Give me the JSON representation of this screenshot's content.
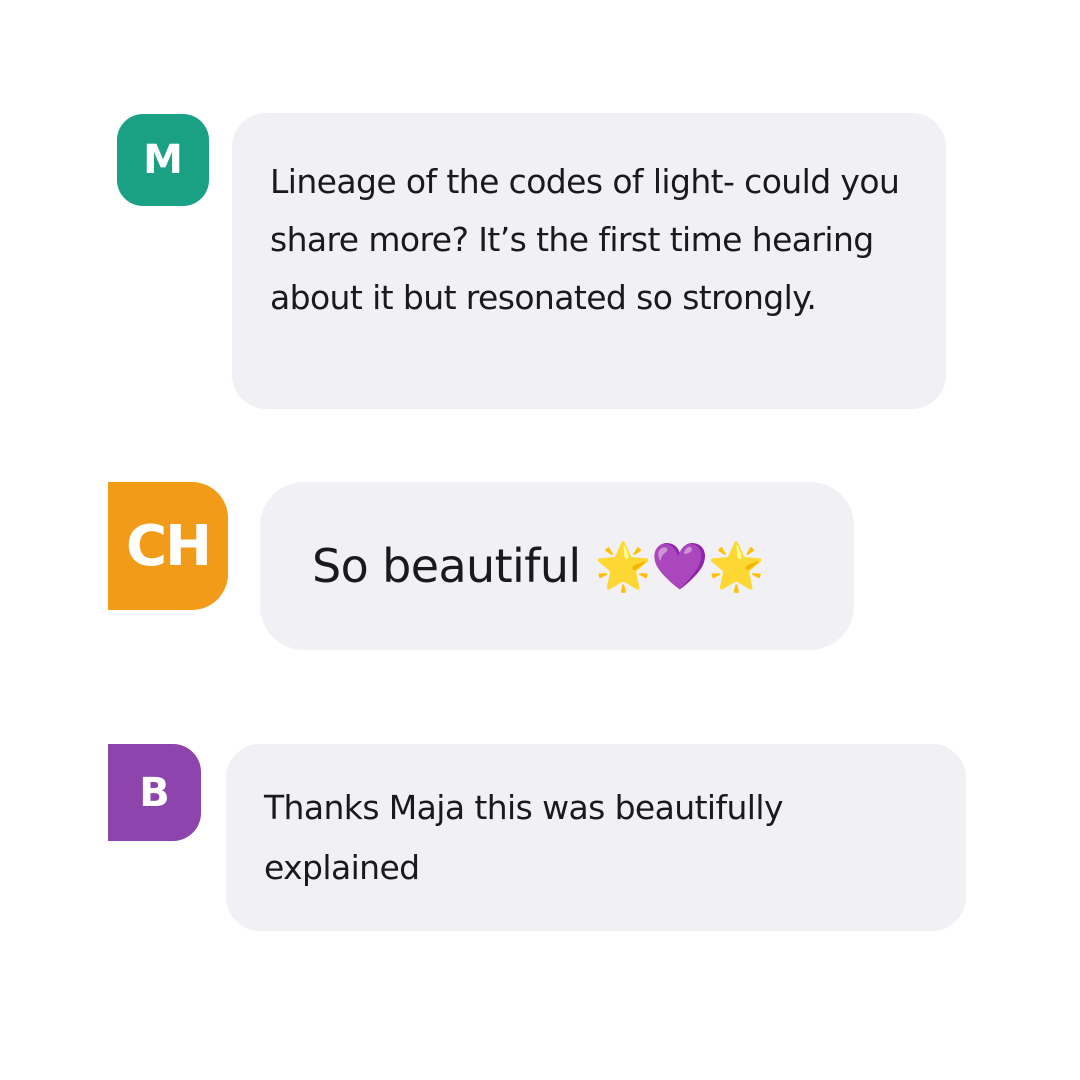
{
  "messages": [
    {
      "avatar": {
        "initials": "M",
        "color": "#1aa183"
      },
      "text": "Lineage of the codes of light- could you share more? It’s the first time hearing about it but resonated so strongly."
    },
    {
      "avatar": {
        "initials": "CH",
        "color": "#f29b18"
      },
      "text": "So beautiful 🌟💜🌟"
    },
    {
      "avatar": {
        "initials": "B",
        "color": "#8e44ad"
      },
      "text": "Thanks Maja this was beautifully explained"
    }
  ],
  "theme": {
    "bubble_bg": "#f1f1f5",
    "text_color": "#1a1a1a",
    "page_bg": "#ffffff"
  }
}
